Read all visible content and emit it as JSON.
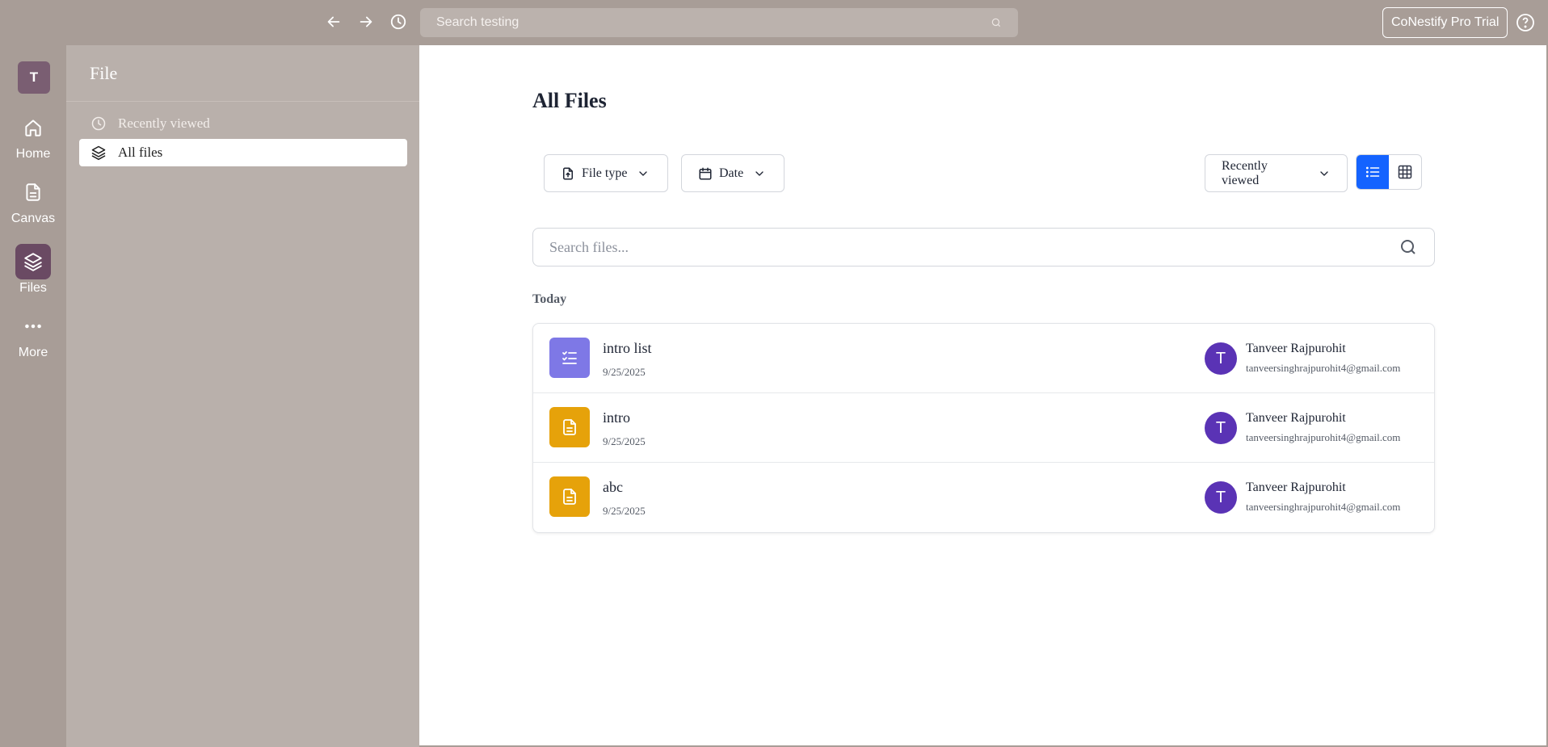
{
  "topbar": {
    "search_placeholder": "Search testing",
    "pro_button": "CoNestify Pro Trial",
    "icons": [
      "back-icon",
      "forward-icon",
      "history-icon",
      "search-icon",
      "help-icon"
    ]
  },
  "rail": {
    "workspace_initial": "T",
    "items": [
      {
        "label": "Home",
        "icon": "home-icon"
      },
      {
        "label": "Canvas",
        "icon": "document-icon"
      },
      {
        "label": "Files",
        "icon": "layers-icon",
        "active": true
      },
      {
        "label": "More",
        "icon": "more-icon"
      }
    ]
  },
  "sidebar": {
    "title": "File",
    "items": [
      {
        "label": "Recently viewed",
        "icon": "clock-icon"
      },
      {
        "label": "All files",
        "icon": "layers-icon",
        "selected": true
      }
    ]
  },
  "main": {
    "title": "All Files",
    "filters": {
      "file_type": "File type",
      "date": "Date",
      "sort": "Recently viewed"
    },
    "view_mode": "list",
    "search_placeholder": "Search files...",
    "group_label": "Today",
    "files": [
      {
        "name": "intro list",
        "date": "9/25/2025",
        "type": "list",
        "owner_initial": "T",
        "owner_name": "Tanveer Rajpurohit",
        "owner_email": "tanveersinghrajpurohit4@gmail.com"
      },
      {
        "name": "intro",
        "date": "9/25/2025",
        "type": "doc",
        "owner_initial": "T",
        "owner_name": "Tanveer Rajpurohit",
        "owner_email": "tanveersinghrajpurohit4@gmail.com"
      },
      {
        "name": "abc",
        "date": "9/25/2025",
        "type": "doc",
        "owner_initial": "T",
        "owner_name": "Tanveer Rajpurohit",
        "owner_email": "tanveersinghrajpurohit4@gmail.com"
      }
    ]
  },
  "colors": {
    "chrome": "#a89d97",
    "sidebar": "#b9b0ab",
    "accent": "#1463ff",
    "avatar": "#5a33b5",
    "list_icon": "#7e78e6",
    "doc_icon": "#e6a20a"
  }
}
